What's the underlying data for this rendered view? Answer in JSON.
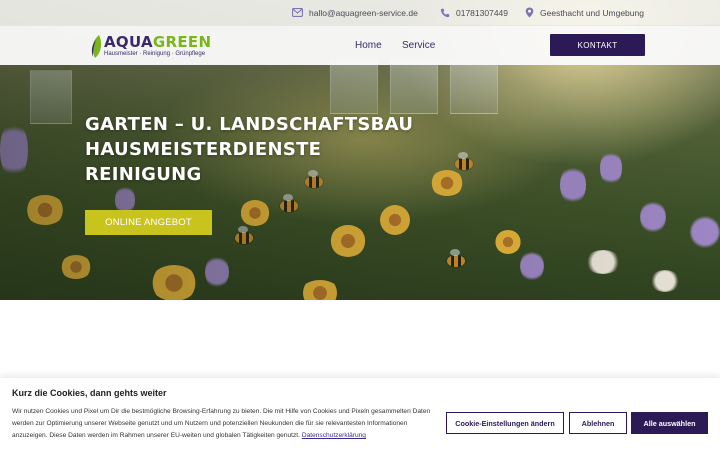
{
  "topbar": {
    "email": "hallo@aquagreen-service.de",
    "phone": "01781307449",
    "location": "Geesthacht und Umgebung"
  },
  "logo": {
    "word_part1": "AQUA",
    "word_part2": "GREEN",
    "tagline": "Hausmeister · Reinigung · Grünpflege"
  },
  "nav": {
    "items": [
      {
        "label": "Home"
      },
      {
        "label": "Service"
      }
    ],
    "cta_label": "KONTAKT"
  },
  "hero": {
    "title_lines": [
      "GARTEN – U. LANDSCHAFTSBAU",
      "HAUSMEISTERDIENSTE",
      "REINIGUNG"
    ],
    "button_label": "ONLINE ANGEBOT"
  },
  "cookie": {
    "title": "Kurz die Cookies, dann gehts weiter",
    "text": "Wir nutzen Cookies und Pixel um Dir die bestmögliche Browsing-Erfahrung zu bieten. Die mit Hilfe von Cookies und Pixeln gesammelten Daten werden zur Optimierung unserer Webseite genutzt und um Nutzern und potenziellen Neukunden die für sie relevantesten Informationen anzuzeigen. Diese Daten werden im Rahmen unserer EU-weiten und globalen Tätigkeiten genutzt.",
    "privacy_link": "Datenschutzerklärung",
    "buttons": {
      "settings": "Cookie-Einstellungen ändern",
      "decline": "Ablehnen",
      "accept_all": "Alle auswählen"
    }
  },
  "colors": {
    "brand_purple": "#2c1a57",
    "brand_green": "#7ab51d",
    "cta_yellow": "#c9c31d"
  },
  "icons": [
    "mail-icon",
    "phone-icon",
    "location-pin-icon",
    "leaf-logo-icon"
  ]
}
